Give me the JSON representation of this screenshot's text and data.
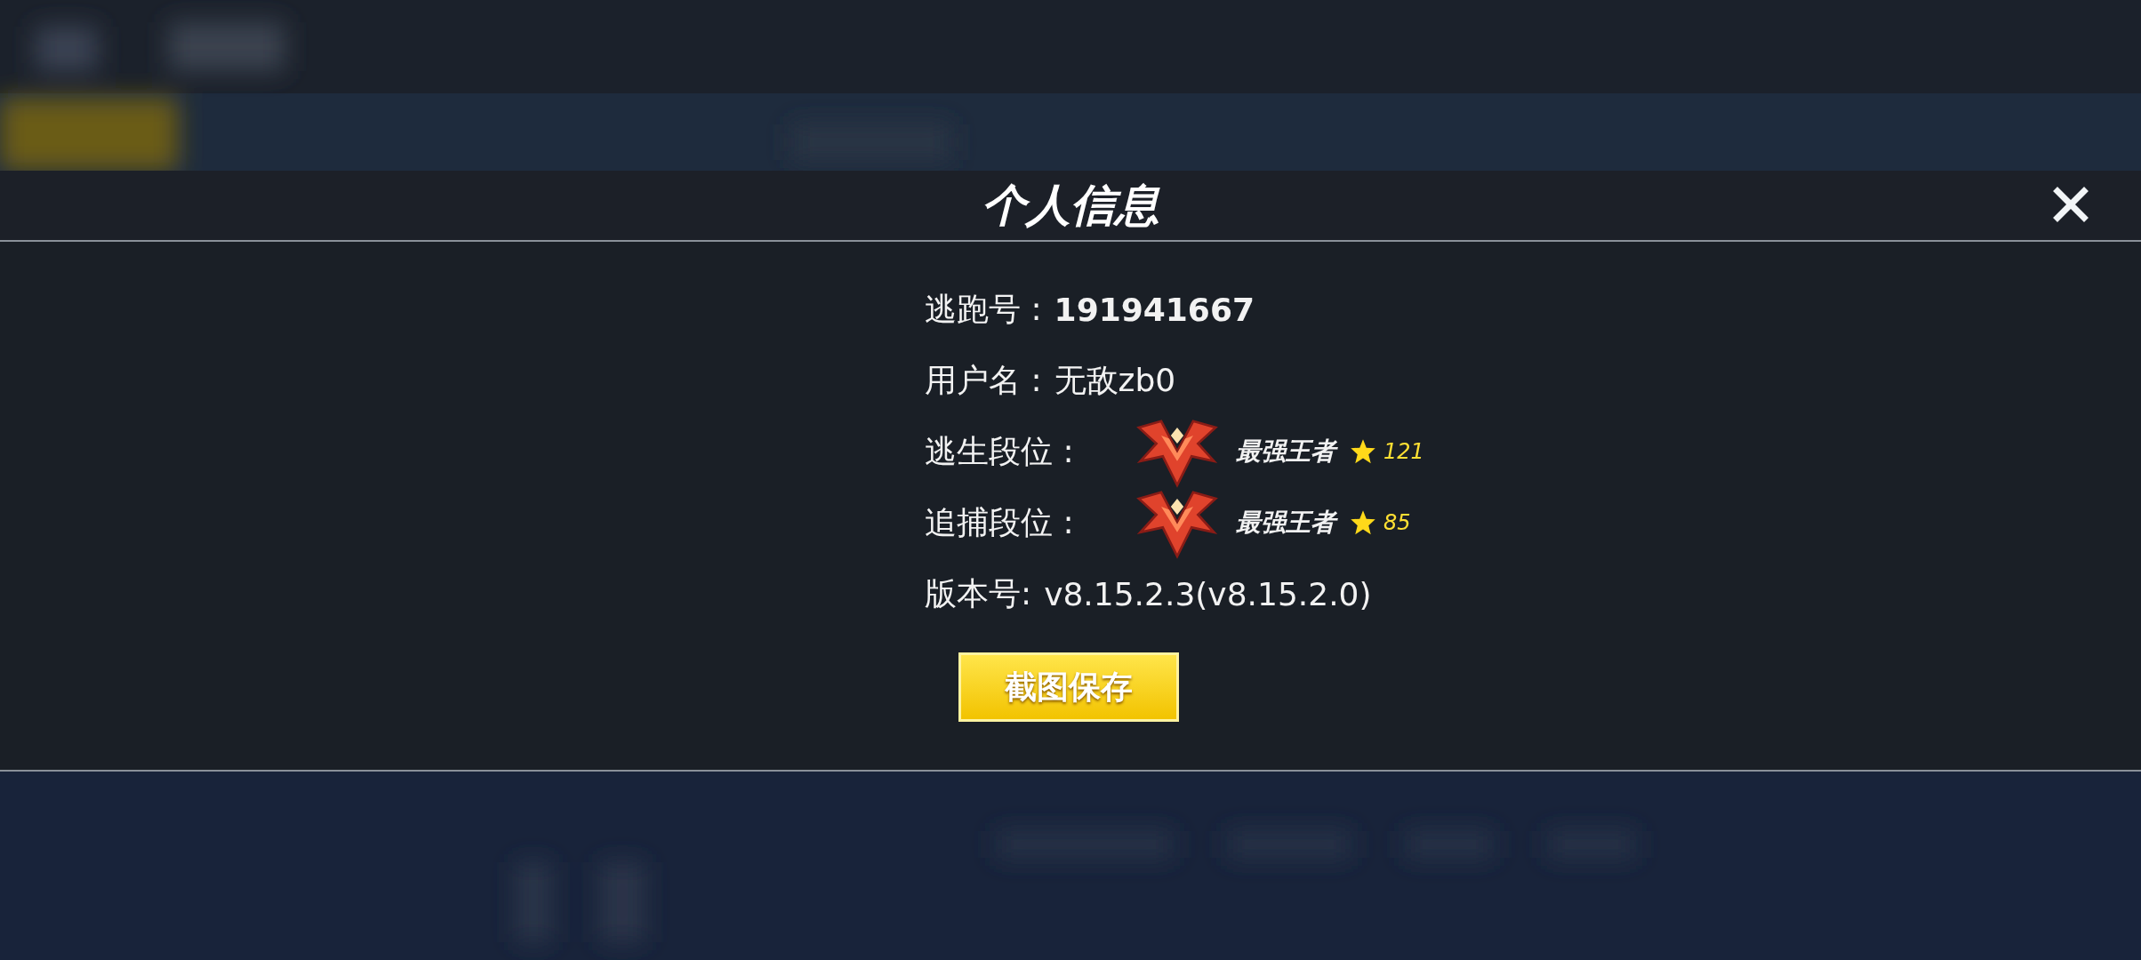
{
  "dialog": {
    "title": "个人信息",
    "player_id": {
      "label": "逃跑号 :",
      "value": "191941667"
    },
    "username": {
      "label": "用户名 :",
      "value": "无敌zb0"
    },
    "ranks": [
      {
        "label": "逃生段位 :",
        "tier": "最强王者",
        "star_count": "121"
      },
      {
        "label": "追捕段位 :",
        "tier": "最强王者",
        "star_count": "85"
      }
    ],
    "version": {
      "label": "版本号:",
      "value": "v8.15.2.3(v8.15.2.0)"
    },
    "button": "截图保存"
  }
}
